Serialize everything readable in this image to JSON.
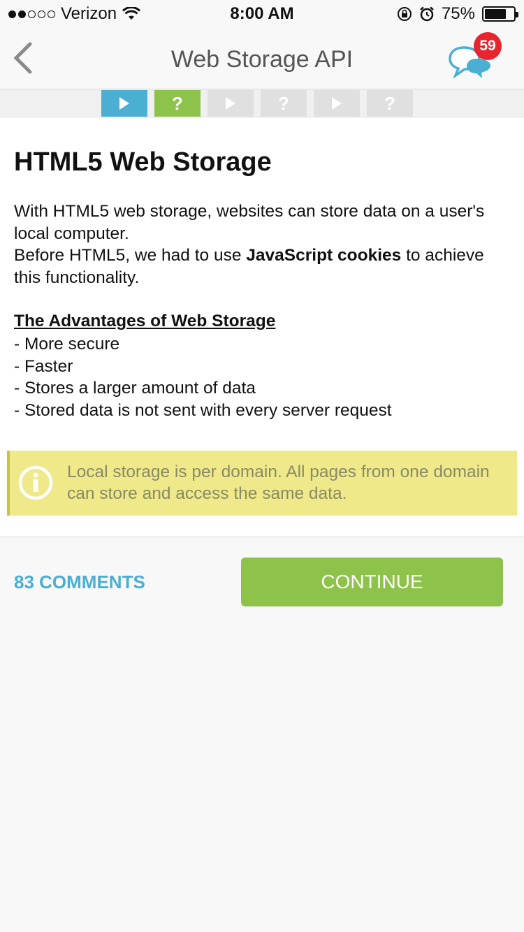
{
  "status_bar": {
    "carrier": "Verizon",
    "time": "8:00 AM",
    "battery": "75%",
    "battery_level": 0.75,
    "signal_dots_filled": 2,
    "signal_dots_total": 5
  },
  "nav": {
    "title": "Web Storage API",
    "chat_badge": "59"
  },
  "progress": {
    "steps": [
      {
        "type": "play",
        "state": "current",
        "color": "#4aafd3"
      },
      {
        "type": "question",
        "label": "?",
        "state": "active",
        "color": "#8dc34a"
      },
      {
        "type": "play",
        "state": "locked"
      },
      {
        "type": "question",
        "label": "?",
        "state": "locked"
      },
      {
        "type": "play",
        "state": "locked"
      },
      {
        "type": "question",
        "label": "?",
        "state": "locked"
      }
    ]
  },
  "lesson": {
    "title": "HTML5 Web Storage",
    "para1": "With HTML5 web storage, websites can store data on a user's local computer.",
    "para2_before": "Before HTML5, we had to use ",
    "para2_bold": "JavaScript cookies",
    "para2_after": " to achieve this functionality.",
    "advantages_heading": "The Advantages of Web Storage",
    "advantages": [
      "- More secure",
      "- Faster",
      "- Stores a larger amount of data",
      "- Stored data is not sent with every server request"
    ],
    "note": "Local storage is per domain. All pages from one domain can store and access the same data."
  },
  "actions": {
    "comments": "83 COMMENTS",
    "continue": "CONTINUE"
  },
  "colors": {
    "accent_blue": "#4aafd3",
    "accent_green": "#8dc34a",
    "badge_red": "#e8242f",
    "note_bg": "#efe98a"
  }
}
